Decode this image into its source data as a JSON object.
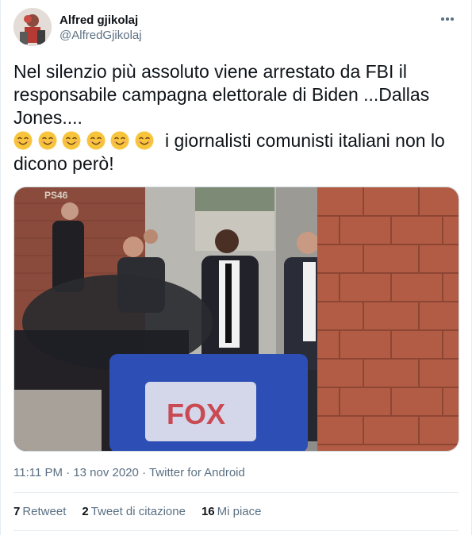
{
  "author": {
    "display_name": "Alfred gjikolaj",
    "handle": "@AlfredGjikolaj"
  },
  "more_icon": "more-horizontal-icon",
  "tweet": {
    "text_line1": "Nel silenzio più assoluto viene arrestato da FBI il responsabile campagna elettorale di Biden ...Dallas Jones....",
    "emoji_name": "smiling-face-with-smiling-eyes",
    "emoji_count": 6,
    "text_line2": "i giornalisti comunisti italiani non lo dicono però!"
  },
  "media": {
    "sign_text": "PS46",
    "mic_text": "FOX"
  },
  "meta": {
    "time": "11:11 PM",
    "separator1": " · ",
    "date": "13 nov 2020",
    "separator2": " · ",
    "source": "Twitter for Android"
  },
  "stats": {
    "retweets_count": "7",
    "retweets_label": "Retweet",
    "quotes_count": "2",
    "quotes_label": "Tweet di citazione",
    "likes_count": "16",
    "likes_label": "Mi piace"
  },
  "colors": {
    "primary_text": "#0f1419",
    "secondary_text": "#5b7083",
    "border": "#e6ecf0",
    "emoji_yellow": "#f7c43c"
  }
}
